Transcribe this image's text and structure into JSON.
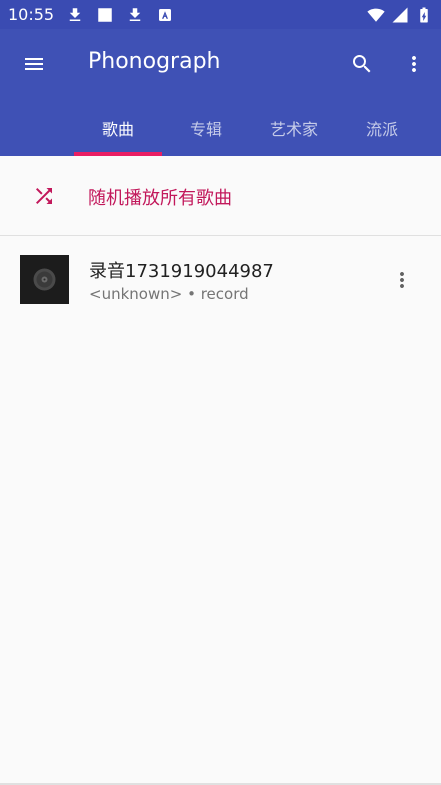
{
  "status_bar": {
    "time": "10:55"
  },
  "app_bar": {
    "title": "Phonograph",
    "tabs": [
      {
        "label": "歌曲",
        "active": true
      },
      {
        "label": "专辑",
        "active": false
      },
      {
        "label": "艺术家",
        "active": false
      },
      {
        "label": "流派",
        "active": false
      }
    ]
  },
  "shuffle": {
    "label": "随机播放所有歌曲"
  },
  "songs": [
    {
      "title": "录音1731919044987",
      "artist": "<unknown>",
      "separator": "•",
      "album": "record"
    }
  ],
  "colors": {
    "primary": "#3f51b5",
    "status_bar": "#3a4bb2",
    "accent": "#e91e63",
    "shuffle_text": "#c2185b",
    "background": "#fafafa"
  }
}
